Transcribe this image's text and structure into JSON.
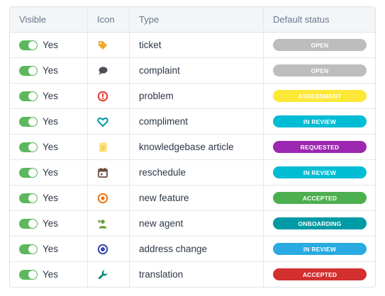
{
  "header": {
    "visible": "Visible",
    "icon": "Icon",
    "type": "Type",
    "default_status": "Default status"
  },
  "rows": [
    {
      "visible": "Yes",
      "icon": "tag-icon",
      "type": "ticket",
      "status": "OPEN",
      "status_color": "#bdbdbd"
    },
    {
      "visible": "Yes",
      "icon": "speech-bubble-icon",
      "type": "complaint",
      "status": "OPEN",
      "status_color": "#bdbdbd"
    },
    {
      "visible": "Yes",
      "icon": "alert-circle-icon",
      "type": "problem",
      "status": "ASSESSMENT",
      "status_color": "#fde838"
    },
    {
      "visible": "Yes",
      "icon": "heart-icon",
      "type": "compliment",
      "status": "IN REVIEW",
      "status_color": "#00bcd4"
    },
    {
      "visible": "Yes",
      "icon": "article-icon",
      "type": "knowledgebase article",
      "status": "REQUESTED",
      "status_color": "#9c27b0"
    },
    {
      "visible": "Yes",
      "icon": "calendar-icon",
      "type": "reschedule",
      "status": "IN REVIEW",
      "status_color": "#00bcd4"
    },
    {
      "visible": "Yes",
      "icon": "target-icon",
      "type": "new feature",
      "status": "ACCEPTED",
      "status_color": "#4caf50"
    },
    {
      "visible": "Yes",
      "icon": "user-add-icon",
      "type": "new agent",
      "status": "ONBOARDING",
      "status_color": "#009aa5"
    },
    {
      "visible": "Yes",
      "icon": "radio-circle-icon",
      "type": "address change",
      "status": "IN REVIEW",
      "status_color": "#29aae0"
    },
    {
      "visible": "Yes",
      "icon": "wrench-icon",
      "type": "translation",
      "status": "ACCEPTED",
      "status_color": "#d32f2f"
    }
  ]
}
